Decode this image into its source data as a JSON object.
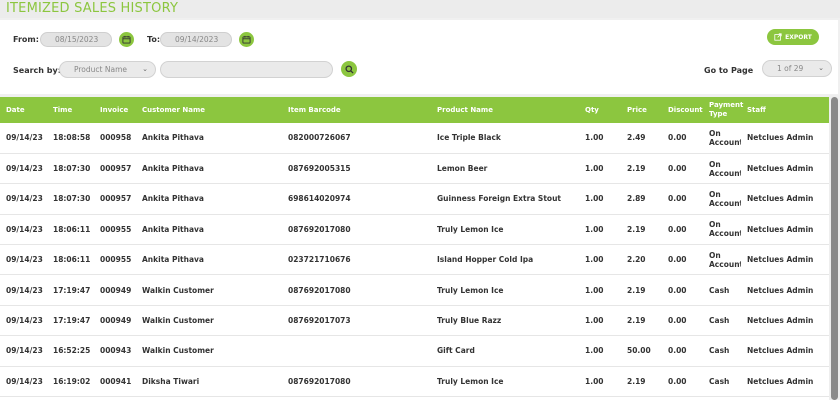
{
  "page": {
    "title": "ITEMIZED SALES HISTORY"
  },
  "filters": {
    "from_label": "From:",
    "from_value": "08/15/2023",
    "to_label": "To:",
    "to_value": "09/14/2023",
    "search_by_label": "Search by:",
    "search_by_value": "Product Name",
    "search_value": "",
    "export_label": "EXPORT",
    "go_to_page_label": "Go to Page",
    "page_select_value": "1 of 29"
  },
  "icons": {
    "calendar": "calendar-icon",
    "export": "external-link-icon",
    "search": "search-icon",
    "chevron": "chevron-down-icon"
  },
  "colors": {
    "accent": "#8cc63f"
  },
  "table": {
    "headers": [
      "Date",
      "Time",
      "Invoice",
      "Customer Name",
      "Item Barcode",
      "Product Name",
      "Qty",
      "Price",
      "Discount",
      "Payment Type",
      "Staff"
    ],
    "rows": [
      [
        "09/14/23",
        "18:08:58",
        "000958",
        "Ankita Pithava",
        "082000726067",
        "Ice Triple Black",
        "1.00",
        "2.49",
        "0.00",
        "On Account",
        "Netclues Admin"
      ],
      [
        "09/14/23",
        "18:07:30",
        "000957",
        "Ankita Pithava",
        "087692005315",
        "Lemon Beer",
        "1.00",
        "2.19",
        "0.00",
        "On Account",
        "Netclues Admin"
      ],
      [
        "09/14/23",
        "18:07:30",
        "000957",
        "Ankita Pithava",
        "698614020974",
        "Guinness Foreign Extra Stout",
        "1.00",
        "2.89",
        "0.00",
        "On Account",
        "Netclues Admin"
      ],
      [
        "09/14/23",
        "18:06:11",
        "000955",
        "Ankita Pithava",
        "087692017080",
        "Truly Lemon Ice",
        "1.00",
        "2.19",
        "0.00",
        "On Account",
        "Netclues Admin"
      ],
      [
        "09/14/23",
        "18:06:11",
        "000955",
        "Ankita Pithava",
        "023721710676",
        "Island Hopper Cold Ipa",
        "1.00",
        "2.20",
        "0.00",
        "On Account",
        "Netclues Admin"
      ],
      [
        "09/14/23",
        "17:19:47",
        "000949",
        "Walkin Customer",
        "087692017080",
        "Truly Lemon Ice",
        "1.00",
        "2.19",
        "0.00",
        "Cash",
        "Netclues Admin"
      ],
      [
        "09/14/23",
        "17:19:47",
        "000949",
        "Walkin Customer",
        "087692017073",
        "Truly Blue Razz",
        "1.00",
        "2.19",
        "0.00",
        "Cash",
        "Netclues Admin"
      ],
      [
        "09/14/23",
        "16:52:25",
        "000943",
        "Walkin Customer",
        "",
        "Gift Card",
        "1.00",
        "50.00",
        "0.00",
        "Cash",
        "Netclues Admin"
      ],
      [
        "09/14/23",
        "16:19:02",
        "000941",
        "Diksha Tiwari",
        "087692017080",
        "Truly Lemon Ice",
        "1.00",
        "2.19",
        "0.00",
        "Cash",
        "Netclues Admin"
      ]
    ]
  }
}
